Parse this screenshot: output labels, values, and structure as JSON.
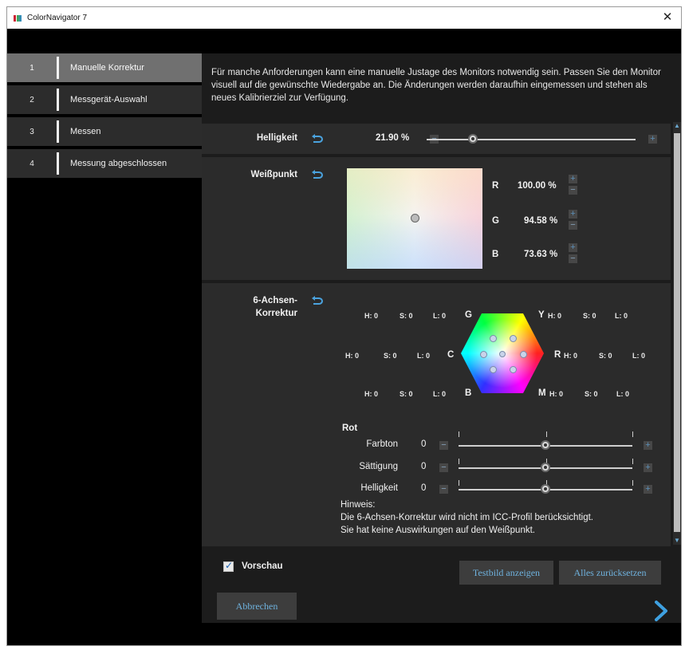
{
  "window": {
    "title": "ColorNavigator 7"
  },
  "sidebar": {
    "items": [
      {
        "number": "1",
        "label": "Manuelle Korrektur",
        "active": true
      },
      {
        "number": "2",
        "label": "Messgerät-Auswahl",
        "active": false
      },
      {
        "number": "3",
        "label": "Messen",
        "active": false
      },
      {
        "number": "4",
        "label": "Messung abgeschlossen",
        "active": false
      }
    ]
  },
  "intro": "Für manche Anforderungen kann eine manuelle Justage des Monitors notwendig sein. Passen Sie den Monitor visuell auf die gewünschte Wiedergabe an. Die Änderungen werden daraufhin eingemessen und stehen als neues Kalibrierziel zur Verfügung.",
  "brightness": {
    "label": "Helligkeit",
    "value": "21.90 %",
    "level": 0.22
  },
  "whitepoint": {
    "label": "Weißpunkt",
    "channels": [
      {
        "name": "R",
        "value": "100.00 %"
      },
      {
        "name": "G",
        "value": "94.58 %"
      },
      {
        "name": "B",
        "value": "73.63 %"
      }
    ]
  },
  "axis6": {
    "label_line1": "6-Achsen-",
    "label_line2": "Korrektur",
    "axes": {
      "G": {
        "letter": "G",
        "h": "H: 0",
        "s": "S: 0",
        "l": "L: 0"
      },
      "Y": {
        "letter": "Y",
        "h": "H: 0",
        "s": "S: 0",
        "l": "L: 0"
      },
      "C": {
        "letter": "C",
        "h": "H: 0",
        "s": "S: 0",
        "l": "L: 0"
      },
      "R": {
        "letter": "R",
        "h": "H: 0",
        "s": "S: 0",
        "l": "L: 0"
      },
      "B": {
        "letter": "B",
        "h": "H: 0",
        "s": "S: 0",
        "l": "L: 0"
      },
      "M": {
        "letter": "M",
        "h": "H: 0",
        "s": "S: 0",
        "l": "L: 0"
      }
    },
    "selected_color": "Rot",
    "sliders": [
      {
        "label": "Farbton",
        "value": "0",
        "level": 0.5
      },
      {
        "label": "Sättigung",
        "value": "0",
        "level": 0.5
      },
      {
        "label": "Helligkeit",
        "value": "0",
        "level": 0.5
      }
    ]
  },
  "note": {
    "heading": "Hinweis:",
    "line1": "Die 6-Achsen-Korrektur wird nicht im ICC-Profil berücksichtigt.",
    "line2": "Sie hat keine Auswirkungen auf den Weißpunkt."
  },
  "footer": {
    "preview_label": "Vorschau",
    "preview_checked": true,
    "show_test_image": "Testbild anzeigen",
    "reset_all": "Alles zurücksetzen",
    "cancel": "Abbrechen"
  },
  "colors": {
    "accent": "#6fb2de",
    "panel": "#2b2b2b",
    "sidebar_active": "#707070"
  }
}
